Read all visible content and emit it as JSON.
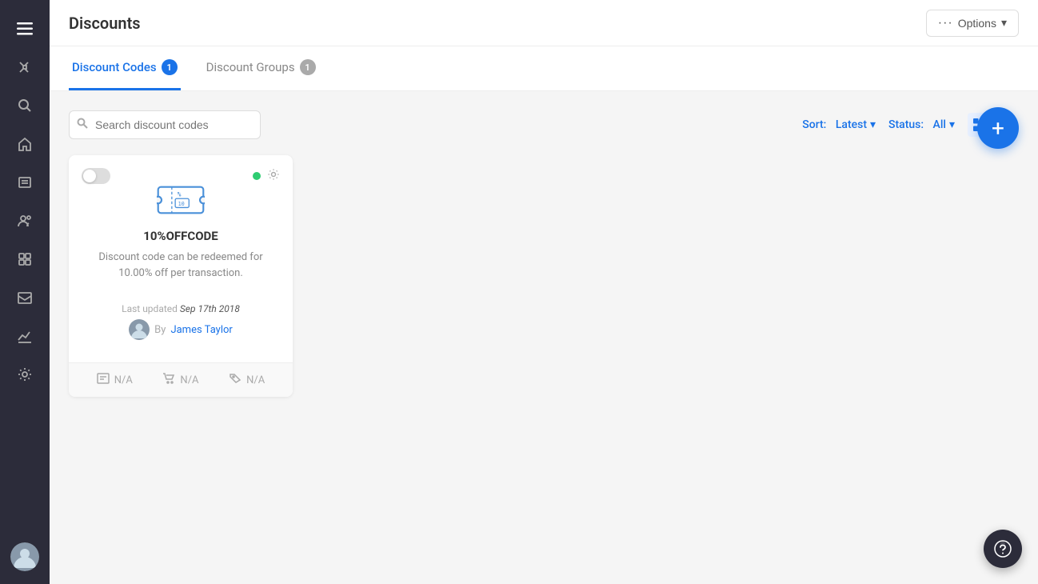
{
  "sidebar": {
    "items": [
      {
        "name": "menu-icon",
        "icon": "☰",
        "active": true
      },
      {
        "name": "tools-icon",
        "icon": "✦"
      },
      {
        "name": "search-icon",
        "icon": "🔍"
      },
      {
        "name": "home-icon",
        "icon": "⌂"
      },
      {
        "name": "pages-icon",
        "icon": "▭"
      },
      {
        "name": "groups-icon",
        "icon": "♟"
      },
      {
        "name": "box-icon",
        "icon": "◻"
      },
      {
        "name": "inbox-icon",
        "icon": "📋"
      },
      {
        "name": "analytics-icon",
        "icon": "📈"
      },
      {
        "name": "settings-icon",
        "icon": "⚙"
      }
    ]
  },
  "topbar": {
    "title": "Discounts",
    "options_button": "Options"
  },
  "tabs": [
    {
      "label": "Discount Codes",
      "badge": "1",
      "active": true
    },
    {
      "label": "Discount Groups",
      "badge": "1",
      "active": false
    }
  ],
  "toolbar": {
    "search_placeholder": "Search discount codes",
    "sort_label": "Sort:",
    "sort_value": "Latest",
    "status_label": "Status:",
    "status_value": "All"
  },
  "fab": {
    "label": "+"
  },
  "cards": [
    {
      "toggle_on": false,
      "status_active": true,
      "code": "10%OFFCODE",
      "description": "Discount code can be redeemed for 10.00% off per transaction.",
      "last_updated_label": "Last updated",
      "last_updated_date": "Sep 17th 2018",
      "author_prefix": "By",
      "author_name": "James Taylor",
      "stats": [
        {
          "icon": "📊",
          "value": "N/A"
        },
        {
          "icon": "🛒",
          "value": "N/A"
        },
        {
          "icon": "🏷",
          "value": "N/A"
        }
      ]
    }
  ],
  "help_button": "?"
}
